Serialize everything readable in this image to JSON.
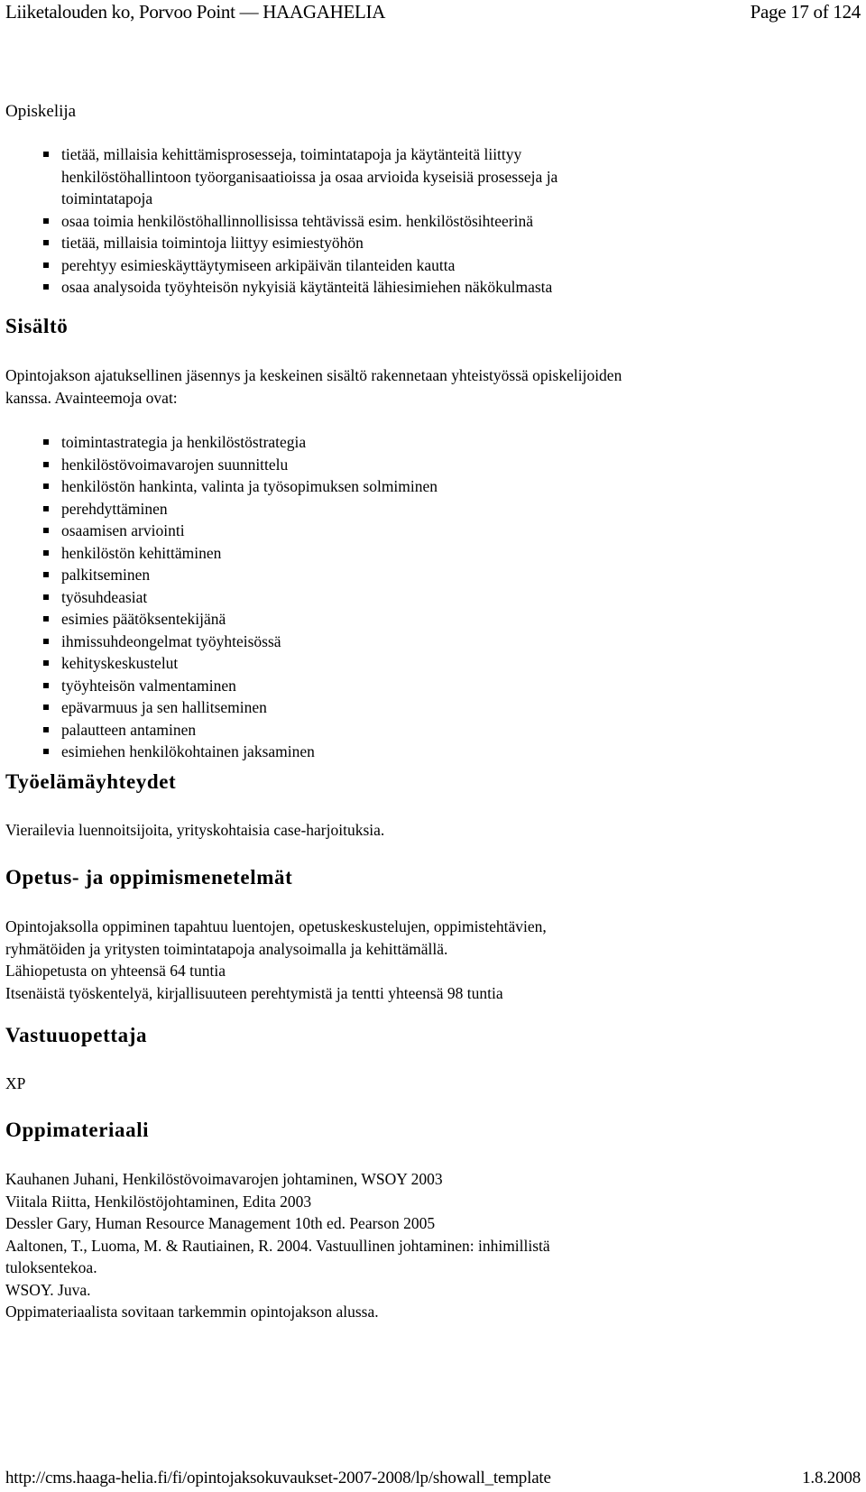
{
  "header": {
    "title": "Liiketalouden ko, Porvoo Point — HAAGAHELIA",
    "page_indicator": "Page 17 of 124"
  },
  "intro_label": "Opiskelija",
  "goals": [
    [
      "tietää, millaisia kehittämisprosesseja, toimintatapoja ja käytänteitä liittyy",
      "henkilöstöhallintoon työorganisaatioissa ja osaa arvioida kyseisiä prosesseja ja",
      "toimintatapoja"
    ],
    [
      "osaa toimia henkilöstöhallinnollisissa tehtävissä esim. henkilöstösihteerinä"
    ],
    [
      "tietää, millaisia toimintoja liittyy esimiestyöhön"
    ],
    [
      "perehtyy esimieskäyttäytymiseen arkipäivän tilanteiden kautta"
    ],
    [
      "osaa analysoida työyhteisön nykyisiä käytänteitä lähiesimiehen näkökulmasta"
    ]
  ],
  "sections": {
    "sisalto": {
      "heading": "Sisältö",
      "lines": [
        "Opintojakson ajatuksellinen jäsennys ja keskeinen sisältö rakennetaan yhteistyössä opiskelijoiden",
        "kanssa. Avainteemoja ovat:"
      ],
      "topics": [
        "toimintastrategia ja henkilöstöstrategia",
        "henkilöstövoimavarojen suunnittelu",
        "henkilöstön hankinta, valinta ja työsopimuksen solmiminen",
        "perehdyttäminen",
        "osaamisen arviointi",
        "henkilöstön kehittäminen",
        "palkitseminen",
        "työsuhdeasiat",
        "esimies päätöksentekijänä",
        "ihmissuhdeongelmat työyhteisössä",
        "kehityskeskustelut",
        "työyhteisön valmentaminen",
        "epävarmuus ja sen hallitseminen",
        "palautteen antaminen",
        "esimiehen henkilökohtainen jaksaminen"
      ]
    },
    "tyoelama": {
      "heading": "Työelämäyhteydet",
      "lines": [
        "Vierailevia luennoitsijoita, yrityskohtaisia case-harjoituksia."
      ]
    },
    "opetus": {
      "heading": "Opetus- ja oppimismenetelmät",
      "lines": [
        "Opintojaksolla oppiminen tapahtuu luentojen, opetuskeskustelujen, oppimistehtävien,",
        "ryhmätöiden ja yritysten toimintatapoja analysoimalla ja kehittämällä.",
        "Lähiopetusta on yhteensä 64 tuntia",
        "Itsenäistä työskentelyä, kirjallisuuteen perehtymistä ja tentti yhteensä 98 tuntia"
      ]
    },
    "vastuu": {
      "heading": "Vastuuopettaja",
      "lines": [
        "XP"
      ]
    },
    "oppimat": {
      "heading": "Oppimateriaali",
      "lines": [
        "Kauhanen Juhani, Henkilöstövoimavarojen johtaminen, WSOY 2003",
        "Viitala Riitta, Henkilöstöjohtaminen, Edita 2003",
        "Dessler Gary, Human Resource Management 10th ed. Pearson 2005",
        "Aaltonen, T., Luoma, M. & Rautiainen, R. 2004. Vastuullinen johtaminen: inhimillistä",
        "tuloksentekoa.",
        "WSOY. Juva.",
        "Oppimateriaalista sovitaan tarkemmin opintojakson alussa."
      ]
    }
  },
  "footer": {
    "url": "http://cms.haaga-helia.fi/fi/opintojaksokuvaukset-2007-2008/lp/showall_template",
    "date": "1.8.2008"
  }
}
